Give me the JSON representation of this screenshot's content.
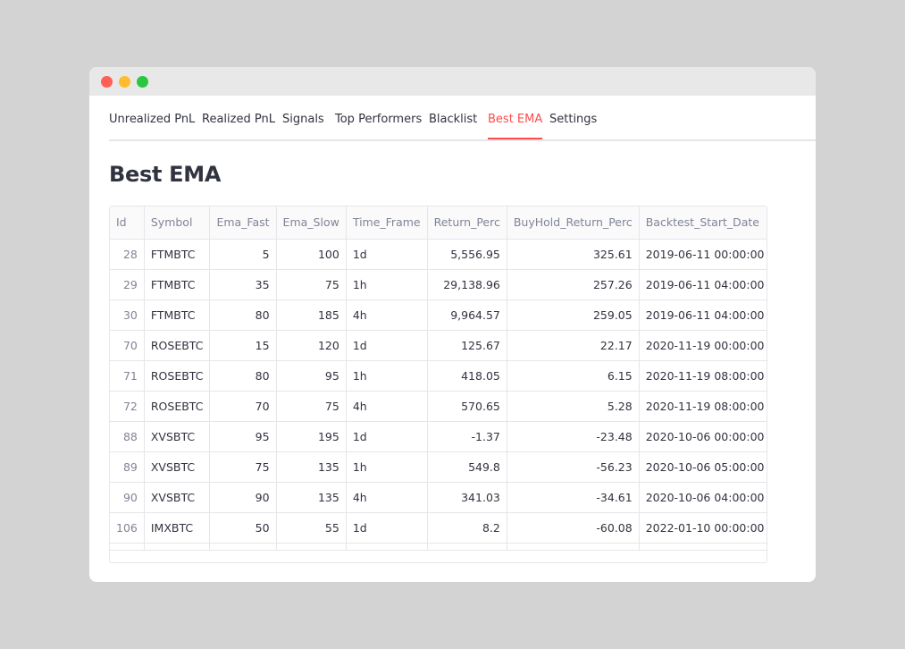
{
  "window": {
    "controls": [
      "close-dot",
      "minimize-dot",
      "zoom-dot"
    ]
  },
  "tabs": [
    {
      "label": "Unrealized PnL",
      "active": false
    },
    {
      "label": "Realized PnL",
      "active": false
    },
    {
      "label": "Signals",
      "active": false
    },
    {
      "label": "Top Performers",
      "active": false
    },
    {
      "label": "Blacklist",
      "active": false
    },
    {
      "label": "Best EMA",
      "active": true
    },
    {
      "label": "Settings",
      "active": false
    }
  ],
  "page": {
    "title": "Best EMA"
  },
  "table": {
    "columns": [
      "Id",
      "Symbol",
      "Ema_Fast",
      "Ema_Slow",
      "Time_Frame",
      "Return_Perc",
      "BuyHold_Return_Perc",
      "Backtest_Start_Date"
    ],
    "rows": [
      [
        "28",
        "FTMBTC",
        "5",
        "100",
        "1d",
        "5,556.95",
        "325.61",
        "2019-06-11 00:00:00"
      ],
      [
        "29",
        "FTMBTC",
        "35",
        "75",
        "1h",
        "29,138.96",
        "257.26",
        "2019-06-11 04:00:00"
      ],
      [
        "30",
        "FTMBTC",
        "80",
        "185",
        "4h",
        "9,964.57",
        "259.05",
        "2019-06-11 04:00:00"
      ],
      [
        "70",
        "ROSEBTC",
        "15",
        "120",
        "1d",
        "125.67",
        "22.17",
        "2020-11-19 00:00:00"
      ],
      [
        "71",
        "ROSEBTC",
        "80",
        "95",
        "1h",
        "418.05",
        "6.15",
        "2020-11-19 08:00:00"
      ],
      [
        "72",
        "ROSEBTC",
        "70",
        "75",
        "4h",
        "570.65",
        "5.28",
        "2020-11-19 08:00:00"
      ],
      [
        "88",
        "XVSBTC",
        "95",
        "195",
        "1d",
        "-1.37",
        "-23.48",
        "2020-10-06 00:00:00"
      ],
      [
        "89",
        "XVSBTC",
        "75",
        "135",
        "1h",
        "549.8",
        "-56.23",
        "2020-10-06 05:00:00"
      ],
      [
        "90",
        "XVSBTC",
        "90",
        "135",
        "4h",
        "341.03",
        "-34.61",
        "2020-10-06 04:00:00"
      ],
      [
        "106",
        "IMXBTC",
        "50",
        "55",
        "1d",
        "8.2",
        "-60.08",
        "2022-01-10 00:00:00"
      ]
    ]
  },
  "colors": {
    "accent": "#ff4b4b",
    "text": "#31333f",
    "muted": "#808495",
    "border": "#e6e6ea",
    "page_bg": "#d3d3d3"
  }
}
